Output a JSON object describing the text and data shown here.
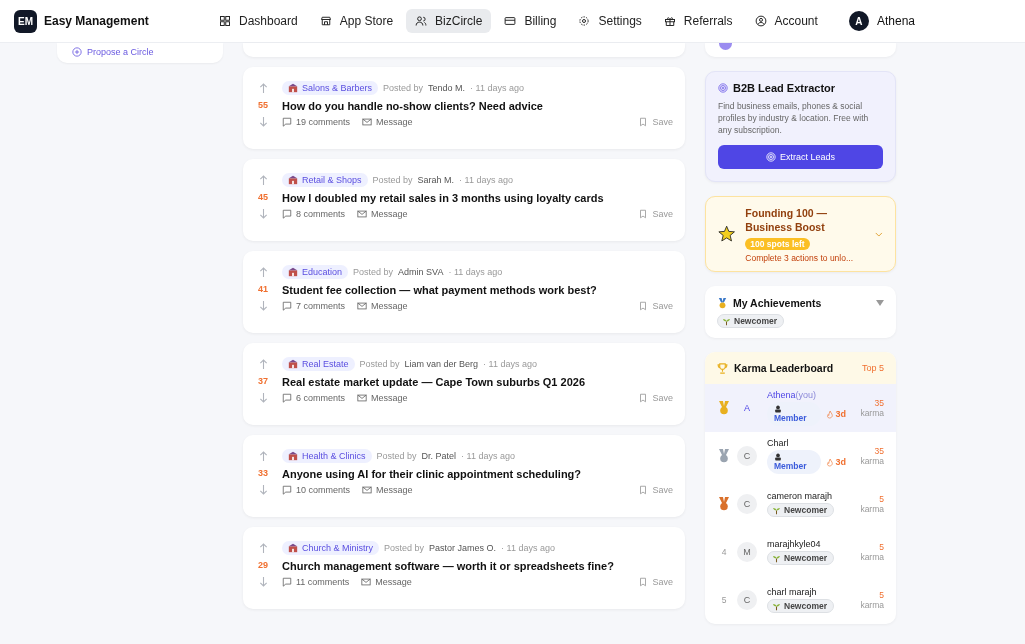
{
  "brand": {
    "logo": "EM",
    "name": "Easy Management"
  },
  "nav": [
    {
      "label": "Dashboard",
      "selected": false
    },
    {
      "label": "App Store",
      "selected": false
    },
    {
      "label": "BizCircle",
      "selected": true
    },
    {
      "label": "Billing",
      "selected": false
    },
    {
      "label": "Settings",
      "selected": false
    },
    {
      "label": "Referrals",
      "selected": false
    },
    {
      "label": "Account",
      "selected": false
    }
  ],
  "user": {
    "initial": "A",
    "name": "Athena"
  },
  "sidebar": {
    "propose_link": "Propose a Circle"
  },
  "posts": [
    {
      "votes": "55",
      "category": "Salons & Barbers",
      "posted_by": "Posted by",
      "author": "Tendo M.",
      "time": "· 11 days ago",
      "title": "How do you handle no-show clients? Need advice",
      "comments": "19 comments",
      "message": "Message",
      "save": "Save"
    },
    {
      "votes": "45",
      "category": "Retail & Shops",
      "posted_by": "Posted by",
      "author": "Sarah M.",
      "time": "· 11 days ago",
      "title": "How I doubled my retail sales in 3 months using loyalty cards",
      "comments": "8 comments",
      "message": "Message",
      "save": "Save"
    },
    {
      "votes": "41",
      "category": "Education",
      "posted_by": "Posted by",
      "author": "Admin SVA",
      "time": "· 11 days ago",
      "title": "Student fee collection — what payment methods work best?",
      "comments": "7 comments",
      "message": "Message",
      "save": "Save"
    },
    {
      "votes": "37",
      "category": "Real Estate",
      "posted_by": "Posted by",
      "author": "Liam van der Berg",
      "time": "· 11 days ago",
      "title": "Real estate market update — Cape Town suburbs Q1 2026",
      "comments": "6 comments",
      "message": "Message",
      "save": "Save"
    },
    {
      "votes": "33",
      "category": "Health & Clinics",
      "posted_by": "Posted by",
      "author": "Dr. Patel",
      "time": "· 11 days ago",
      "title": "Anyone using AI for their clinic appointment scheduling?",
      "comments": "10 comments",
      "message": "Message",
      "save": "Save"
    },
    {
      "votes": "29",
      "category": "Church & Ministry",
      "posted_by": "Posted by",
      "author": "Pastor James O.",
      "time": "· 11 days ago",
      "title": "Church management software — worth it or spreadsheets fine?",
      "comments": "11 comments",
      "message": "Message",
      "save": "Save"
    }
  ],
  "lead_extractor": {
    "title": "B2B Lead Extractor",
    "text": "Find business emails, phones & social profiles by industry & location. Free with any subscription.",
    "button": "Extract Leads"
  },
  "founding": {
    "title": "Founding 100 — Business Boost",
    "pill": "100 spots left",
    "text": "Complete 3 actions to unlo...",
    "expanded": false
  },
  "achievements": {
    "title": "My Achievements",
    "badges": [
      "Newcomer"
    ],
    "expanded": false
  },
  "leaderboard": {
    "title": "Karma Leaderboard",
    "scope": "Top 5",
    "rows": [
      {
        "rank": {
          "kind": "medal",
          "color": "#e8b020"
        },
        "initial": "A",
        "name": "Athena",
        "you": "(you)",
        "highlighted": true,
        "badge": {
          "kind": "member",
          "label": "Member"
        },
        "streak": "3d",
        "karma": "35",
        "unit": "karma"
      },
      {
        "rank": {
          "kind": "medal",
          "color": "#9aa4b0"
        },
        "initial": "C",
        "name": "Charl",
        "highlighted": false,
        "badge": {
          "kind": "member",
          "label": "Member"
        },
        "streak": "3d",
        "karma": "35",
        "unit": "karma"
      },
      {
        "rank": {
          "kind": "medal",
          "color": "#d9702a"
        },
        "initial": "C",
        "name": "cameron marajh",
        "highlighted": false,
        "badge": {
          "kind": "newcomer",
          "label": "Newcomer"
        },
        "karma": "5",
        "unit": "karma"
      },
      {
        "rank": {
          "kind": "number",
          "text": "4"
        },
        "initial": "M",
        "name": "marajhkyle04",
        "highlighted": false,
        "badge": {
          "kind": "newcomer",
          "label": "Newcomer"
        },
        "karma": "5",
        "unit": "karma"
      },
      {
        "rank": {
          "kind": "number",
          "text": "5"
        },
        "initial": "C",
        "name": "charl marajh",
        "highlighted": false,
        "badge": {
          "kind": "newcomer",
          "label": "Newcomer"
        },
        "karma": "5",
        "unit": "karma"
      }
    ]
  }
}
